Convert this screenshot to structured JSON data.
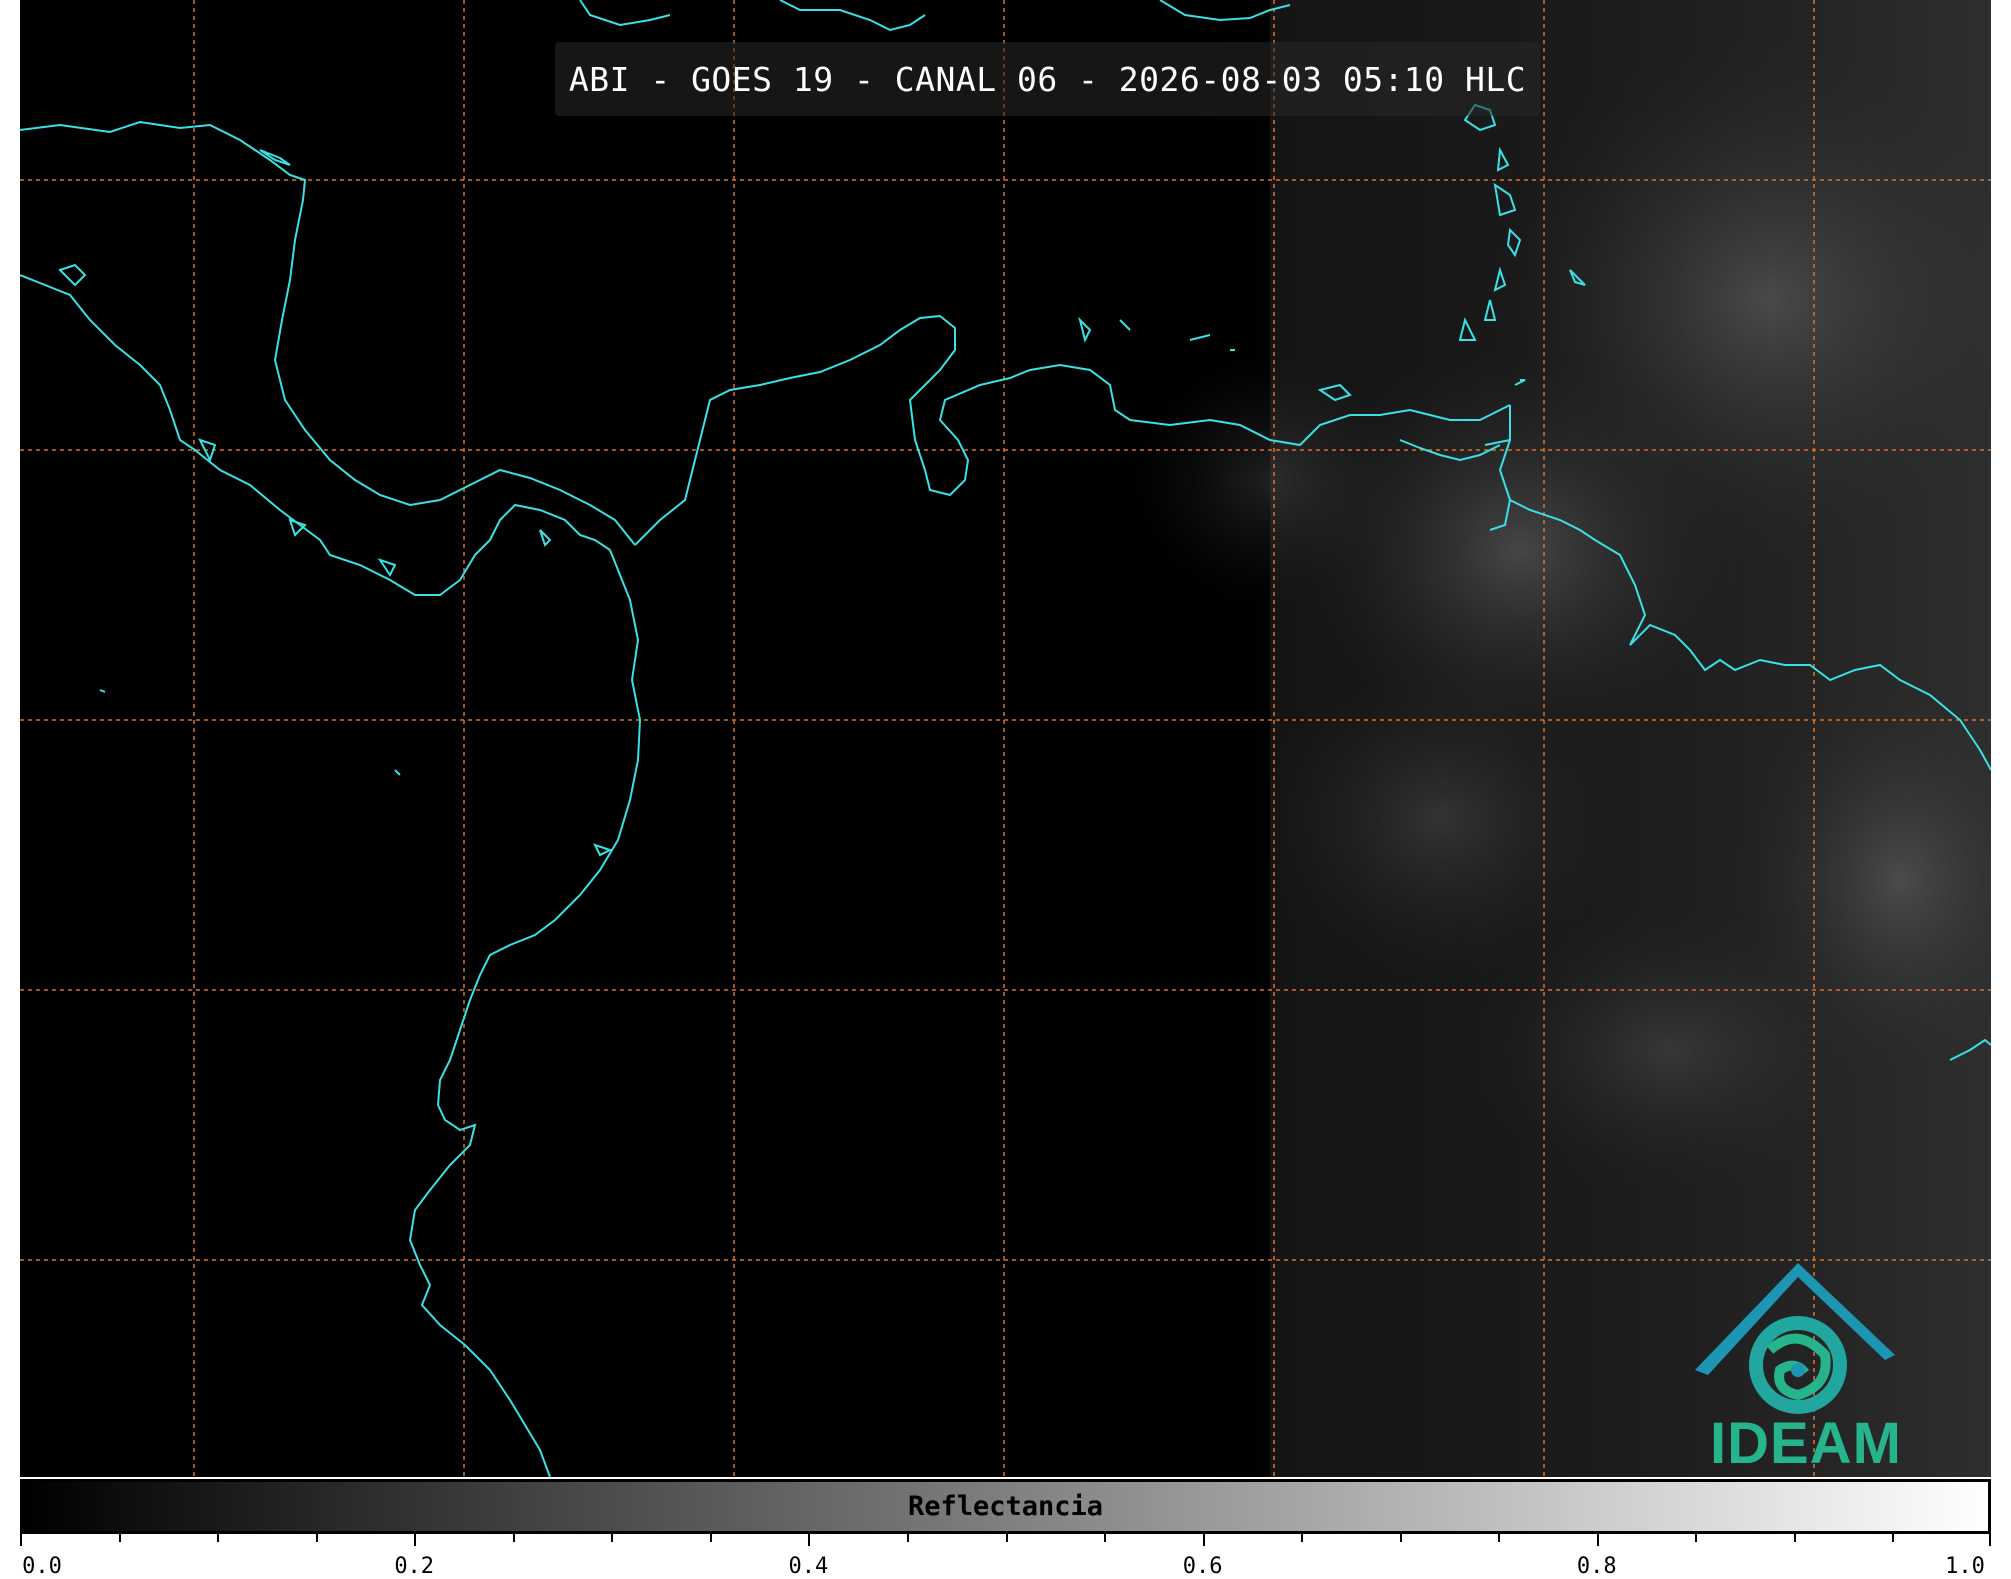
{
  "header": {
    "title": "ABI - GOES 19 - CANAL 06 - 2026-08-03 05:10 HLC"
  },
  "map": {
    "coastline_color": "#39e1e4",
    "grid_color": "#d9732a",
    "background_color": "#000000",
    "cloud_region": "east"
  },
  "logo": {
    "text": "IDEAM",
    "primary_color": "#1d96b4",
    "secondary_color": "#25b48c"
  },
  "colorbar": {
    "label": "Reflectancia",
    "min": 0.0,
    "max": 1.0,
    "tick_labels": [
      "0.0",
      "0.2",
      "0.4",
      "0.6",
      "0.8",
      "1.0"
    ],
    "colors": [
      "#000000",
      "#ffffff"
    ]
  }
}
